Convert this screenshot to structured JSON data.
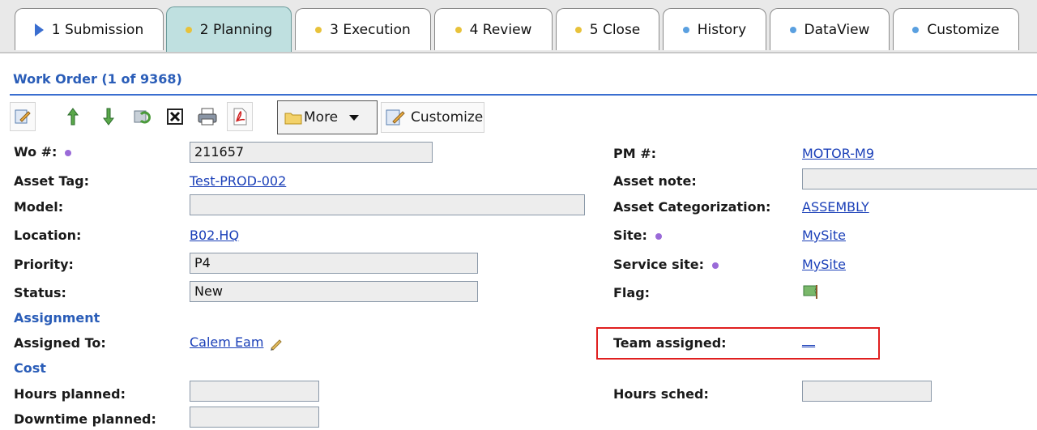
{
  "tabs": [
    {
      "label": "1 Submission",
      "icon": "play-triangle-icon",
      "color": "#3a6ed0",
      "active": false
    },
    {
      "label": "2 Planning",
      "icon": "yellow-dot-icon",
      "color": "#e8c23a",
      "active": true
    },
    {
      "label": "3 Execution",
      "icon": "yellow-dot-icon",
      "color": "#e8c23a",
      "active": false
    },
    {
      "label": "4 Review",
      "icon": "yellow-dot-icon",
      "color": "#e8c23a",
      "active": false
    },
    {
      "label": "5 Close",
      "icon": "yellow-dot-icon",
      "color": "#e8c23a",
      "active": false
    },
    {
      "label": "History",
      "icon": "blue-dot-icon",
      "color": "#5aa0e0",
      "active": false
    },
    {
      "label": "DataView",
      "icon": "blue-dot-icon",
      "color": "#5aa0e0",
      "active": false
    },
    {
      "label": "Customize",
      "icon": "blue-dot-icon",
      "color": "#5aa0e0",
      "active": false
    }
  ],
  "title": "Work Order (1 of 9368)",
  "toolbar": {
    "more_label": "More",
    "customize_label": "Customize"
  },
  "form": {
    "wo_label": "Wo #:",
    "wo_value": "211657",
    "pm_label": "PM #:",
    "pm_value": "MOTOR-M9",
    "asset_tag_label": "Asset Tag:",
    "asset_tag_value": "Test-PROD-002",
    "asset_note_label": "Asset note:",
    "asset_note_value": "",
    "model_label": "Model:",
    "model_value": "",
    "asset_cat_label": "Asset Categorization:",
    "asset_cat_value": "ASSEMBLY",
    "location_label": "Location:",
    "location_value": "B02.HQ",
    "site_label": "Site:",
    "site_value": "MySite",
    "priority_label": "Priority:",
    "priority_value": "P4",
    "service_site_label": "Service site:",
    "service_site_value": "MySite",
    "status_label": "Status:",
    "status_value": "New",
    "flag_label": "Flag:",
    "assignment_section": "Assignment",
    "assigned_to_label": "Assigned To:",
    "assigned_to_value": "Calem Eam",
    "team_assigned_label": "Team assigned:",
    "team_assigned_value": "__",
    "cost_section": "Cost",
    "hours_planned_label": "Hours planned:",
    "hours_planned_value": "",
    "hours_sched_label": "Hours sched:",
    "hours_sched_value": "",
    "downtime_planned_label": "Downtime planned:",
    "downtime_planned_value": ""
  },
  "colors": {
    "accent": "#2a5db8",
    "active_tab": "#bfe0e0",
    "highlight": "#e01f1f",
    "required_dot": "#9a6ad8"
  }
}
